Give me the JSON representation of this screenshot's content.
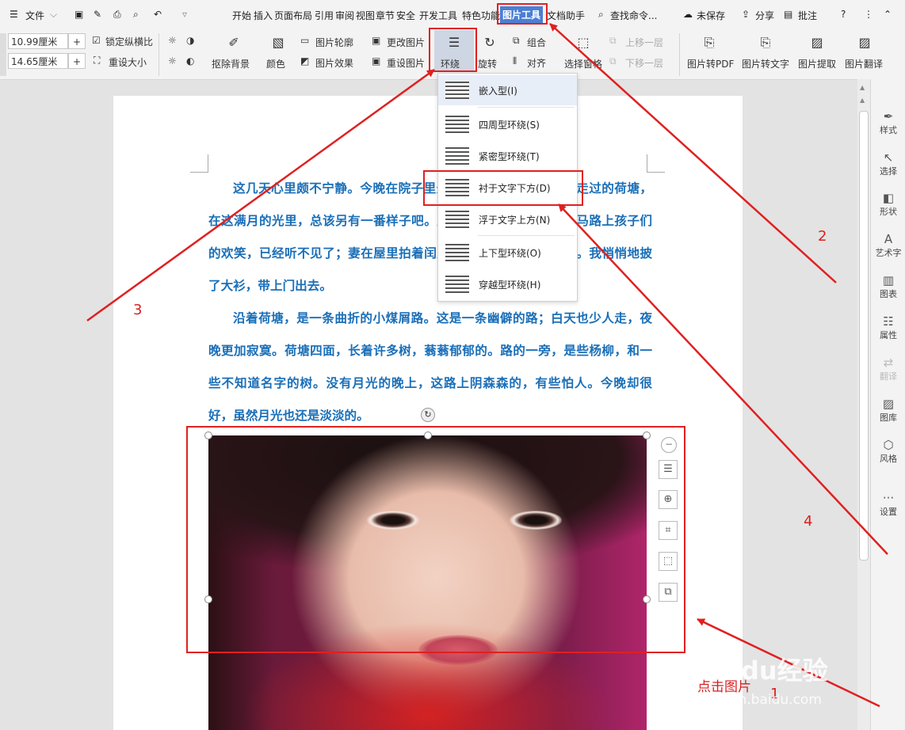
{
  "menubar": {
    "file": "文件",
    "tabs": [
      "开始",
      "插入",
      "页面布局",
      "引用",
      "审阅",
      "视图",
      "章节",
      "安全",
      "开发工具",
      "特色功能",
      "图片工具",
      "文档助手"
    ],
    "active_tab": "图片工具",
    "search": "查找命令...",
    "unsaved": "未保存",
    "share": "分享",
    "comment": "批注"
  },
  "ribbon": {
    "width_value": "10.99厘米",
    "height_value": "14.65厘米",
    "lock_ratio": "锁定纵横比",
    "reset_size": "重设大小",
    "remove_bg": "抠除背景",
    "color": "颜色",
    "outline": "图片轮廓",
    "effect": "图片效果",
    "change_pic": "更改图片",
    "reset_pic": "重设图片",
    "wrap": "环绕",
    "rotate": "旋转",
    "group": "组合",
    "align": "对齐",
    "select_pane": "选择窗格",
    "bring_forward": "上移一层",
    "send_backward": "下移一层",
    "to_pdf": "图片转PDF",
    "to_text": "图片转文字",
    "extract": "图片提取",
    "translate": "图片翻译"
  },
  "wrap_menu": [
    {
      "label": "嵌入型(I)"
    },
    {
      "label": "四周型环绕(S)"
    },
    {
      "label": "紧密型环绕(T)"
    },
    {
      "label": "衬于文字下方(D)"
    },
    {
      "label": "浮于文字上方(N)"
    },
    {
      "label": "上下型环绕(O)"
    },
    {
      "label": "穿越型环绕(H)"
    }
  ],
  "document": {
    "p1": "这几天心里颇不宁静。今晚在院子里坐着乘凉，忽然想起日日走过的荷塘，在这满月的光里，总该另有一番样子吧。月亮渐渐地升高了，墙外马路上孩子们的欢笑，已经听不见了；妻在屋里拍着闰儿，迷迷糊糊地哼着眠歌。我悄悄地披了大衫，带上门出去。",
    "p2": "沿着荷塘，是一条曲折的小煤屑路。这是一条幽僻的路；白天也少人走，夜晚更加寂寞。荷塘四面，长着许多树，蓊蓊郁郁的。路的一旁，是些杨柳，和一些不知道名字的树。没有月光的晚上，这路上阴森森的，有些怕人。今晚却很好，虽然月光也还是淡淡的。"
  },
  "sidebar": [
    {
      "label": "样式"
    },
    {
      "label": "选择"
    },
    {
      "label": "形状"
    },
    {
      "label": "艺术字"
    },
    {
      "label": "图表"
    },
    {
      "label": "属性"
    },
    {
      "label": "翻译"
    },
    {
      "label": "图库"
    },
    {
      "label": "风格"
    },
    {
      "label": "设置"
    }
  ],
  "annotations": {
    "n1": "1",
    "n2": "2",
    "n3": "3",
    "n4": "4",
    "click_pic": "点击图片",
    "watermark": "Baidu经验",
    "watermark_url": "jingyan.baidu.com"
  },
  "colors": {
    "annotation": "#e02020",
    "doc_text": "#1a6fb8",
    "active_tab_bg": "#4a7fd4"
  }
}
